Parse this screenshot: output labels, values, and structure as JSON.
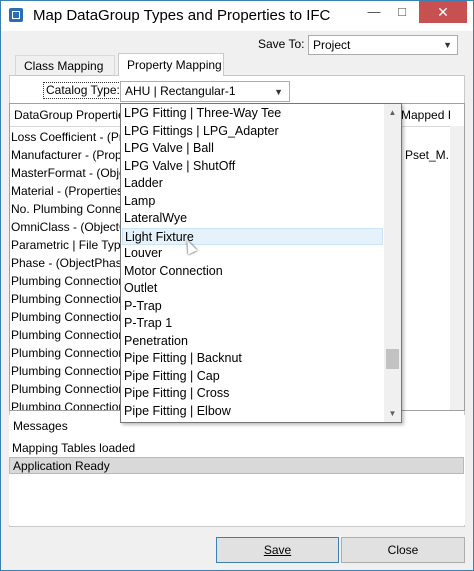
{
  "window": {
    "title": "Map DataGroup Types and Properties to IFC",
    "min_icon": "minimize-icon",
    "max_icon": "maximize-icon",
    "close_icon": "close-icon"
  },
  "save_to": {
    "label": "Save To:",
    "value": "Project"
  },
  "tabs": [
    {
      "label": "Class Mapping"
    },
    {
      "label": "Property Mapping"
    }
  ],
  "catalog": {
    "label": "Catalog Type:",
    "value": "AHU | Rectangular-1"
  },
  "grid": {
    "headers": [
      "DataGroup Propertie",
      "Mapped I"
    ],
    "rows": [
      "Loss Coefficient - (Pro",
      "Manufacturer - (Prope",
      "MasterFormat - (Objec",
      "Material - (Properties/",
      "No. Plumbing Connec",
      "OmniClass - (ObjectCl",
      "Parametric | File Type",
      "Phase - (ObjectPhasin",
      "Plumbing Connection",
      "Plumbing Connection",
      "Plumbing Connection",
      "Plumbing Connection",
      "Plumbing Connection",
      "Plumbing Connection",
      "Plumbing Connection",
      "Plumbing Connection"
    ],
    "mapped_cell": "Pset_M..."
  },
  "dropdown": {
    "items": [
      "LPG Fitting | Three-Way Tee",
      "LPG Fittings | LPG_Adapter",
      "LPG Valve | Ball",
      "LPG Valve | ShutOff",
      "Ladder",
      "Lamp",
      "LateralWye",
      "Light Fixture",
      "Louver",
      "Motor Connection",
      "Outlet",
      "P-Trap",
      "P-Trap 1",
      "Penetration",
      "Pipe Fitting | Backnut",
      "Pipe Fitting | Cap",
      "Pipe Fitting | Cross",
      "Pipe Fitting | Elbow"
    ],
    "hovered_index": 7
  },
  "messages": {
    "header": "Messages",
    "lines": [
      "Mapping Tables loaded",
      "Application Ready"
    ]
  },
  "buttons": {
    "save": "Save",
    "close": "Close"
  }
}
